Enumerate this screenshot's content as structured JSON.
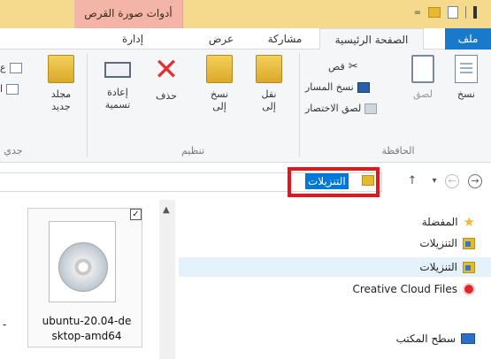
{
  "titlebar": {
    "context_tab_label": "أدوات صورة القرص",
    "quick_access_dropdown": "="
  },
  "ribbon_tabs": {
    "file": "ملف",
    "home": "الصفحة الرئيسية",
    "share": "مشاركة",
    "view": "عرض",
    "manage": "إدارة"
  },
  "clipboard_group": {
    "label": "الحافظة",
    "copy": "نسخ",
    "paste": "لصق",
    "cut": "قص",
    "copy_path": "نسخ المسار",
    "paste_shortcut": "لصق الاختصار"
  },
  "organize_group": {
    "label": "تنظيم",
    "move_to_line1": "نقل",
    "move_to_line2": "إلى",
    "copy_to_line1": "نسخ",
    "copy_to_line2": "إلى",
    "delete": "حذف",
    "rename_line1": "إعادة",
    "rename_line2": "تسمية"
  },
  "new_group": {
    "label": "جدي",
    "new_folder_line1": "مجلد",
    "new_folder_line2": "جديد",
    "new_item_partial": "ع",
    "easy_access_partial": "ا"
  },
  "address_bar": {
    "current_folder": "التنزيلات",
    "dropdown_arrow": "▾",
    "up_arrow": "↑",
    "back_arrow": "→",
    "forward_arrow": "←"
  },
  "file_pane": {
    "items": [
      {
        "name": "ubuntu-20.04-desktop-amd64",
        "line1": "ubuntu-20.04-de",
        "line2": "sktop-amd64",
        "checked": true
      }
    ],
    "dash": "-",
    "checkmark": "✓"
  },
  "nav_pane": {
    "favorites": "المفضلة",
    "downloads_1": "التنزيلات",
    "downloads_2": "التنزيلات",
    "creative_cloud": "Creative Cloud Files",
    "desktop": "سطح المكتب"
  },
  "colors": {
    "file_tab": "#1979ca",
    "title_bar": "#f5d98c",
    "context_tab": "#f4b5a8",
    "selection": "#0078d7",
    "highlight_box": "#e8141c",
    "nav_selected": "#e5f1fb"
  }
}
